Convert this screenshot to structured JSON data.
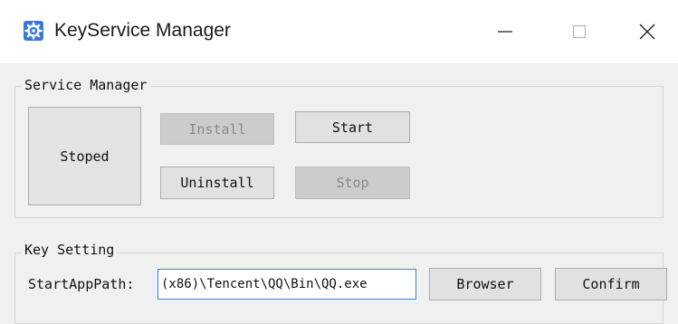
{
  "window": {
    "title": "KeyService Manager",
    "controls": {
      "minimize": "minimize",
      "maximize": "maximize",
      "close": "close"
    }
  },
  "service_manager": {
    "label": "Service Manager",
    "status": "Stoped",
    "install_label": "Install",
    "start_label": "Start",
    "uninstall_label": "Uninstall",
    "stop_label": "Stop"
  },
  "key_setting": {
    "label": "Key Setting",
    "start_app_path_label": "StartAppPath:",
    "start_app_path_value": "(x86)\\Tencent\\QQ\\Bin\\QQ.exe",
    "browser_label": "Browser",
    "confirm_label": "Confirm"
  },
  "colors": {
    "accent": "#3c7fd6",
    "window_bg": "#f0f0f0",
    "disabled_button": "#cccccc"
  },
  "icons": [
    "gear-icon",
    "minimize-icon",
    "maximize-icon",
    "close-icon"
  ]
}
